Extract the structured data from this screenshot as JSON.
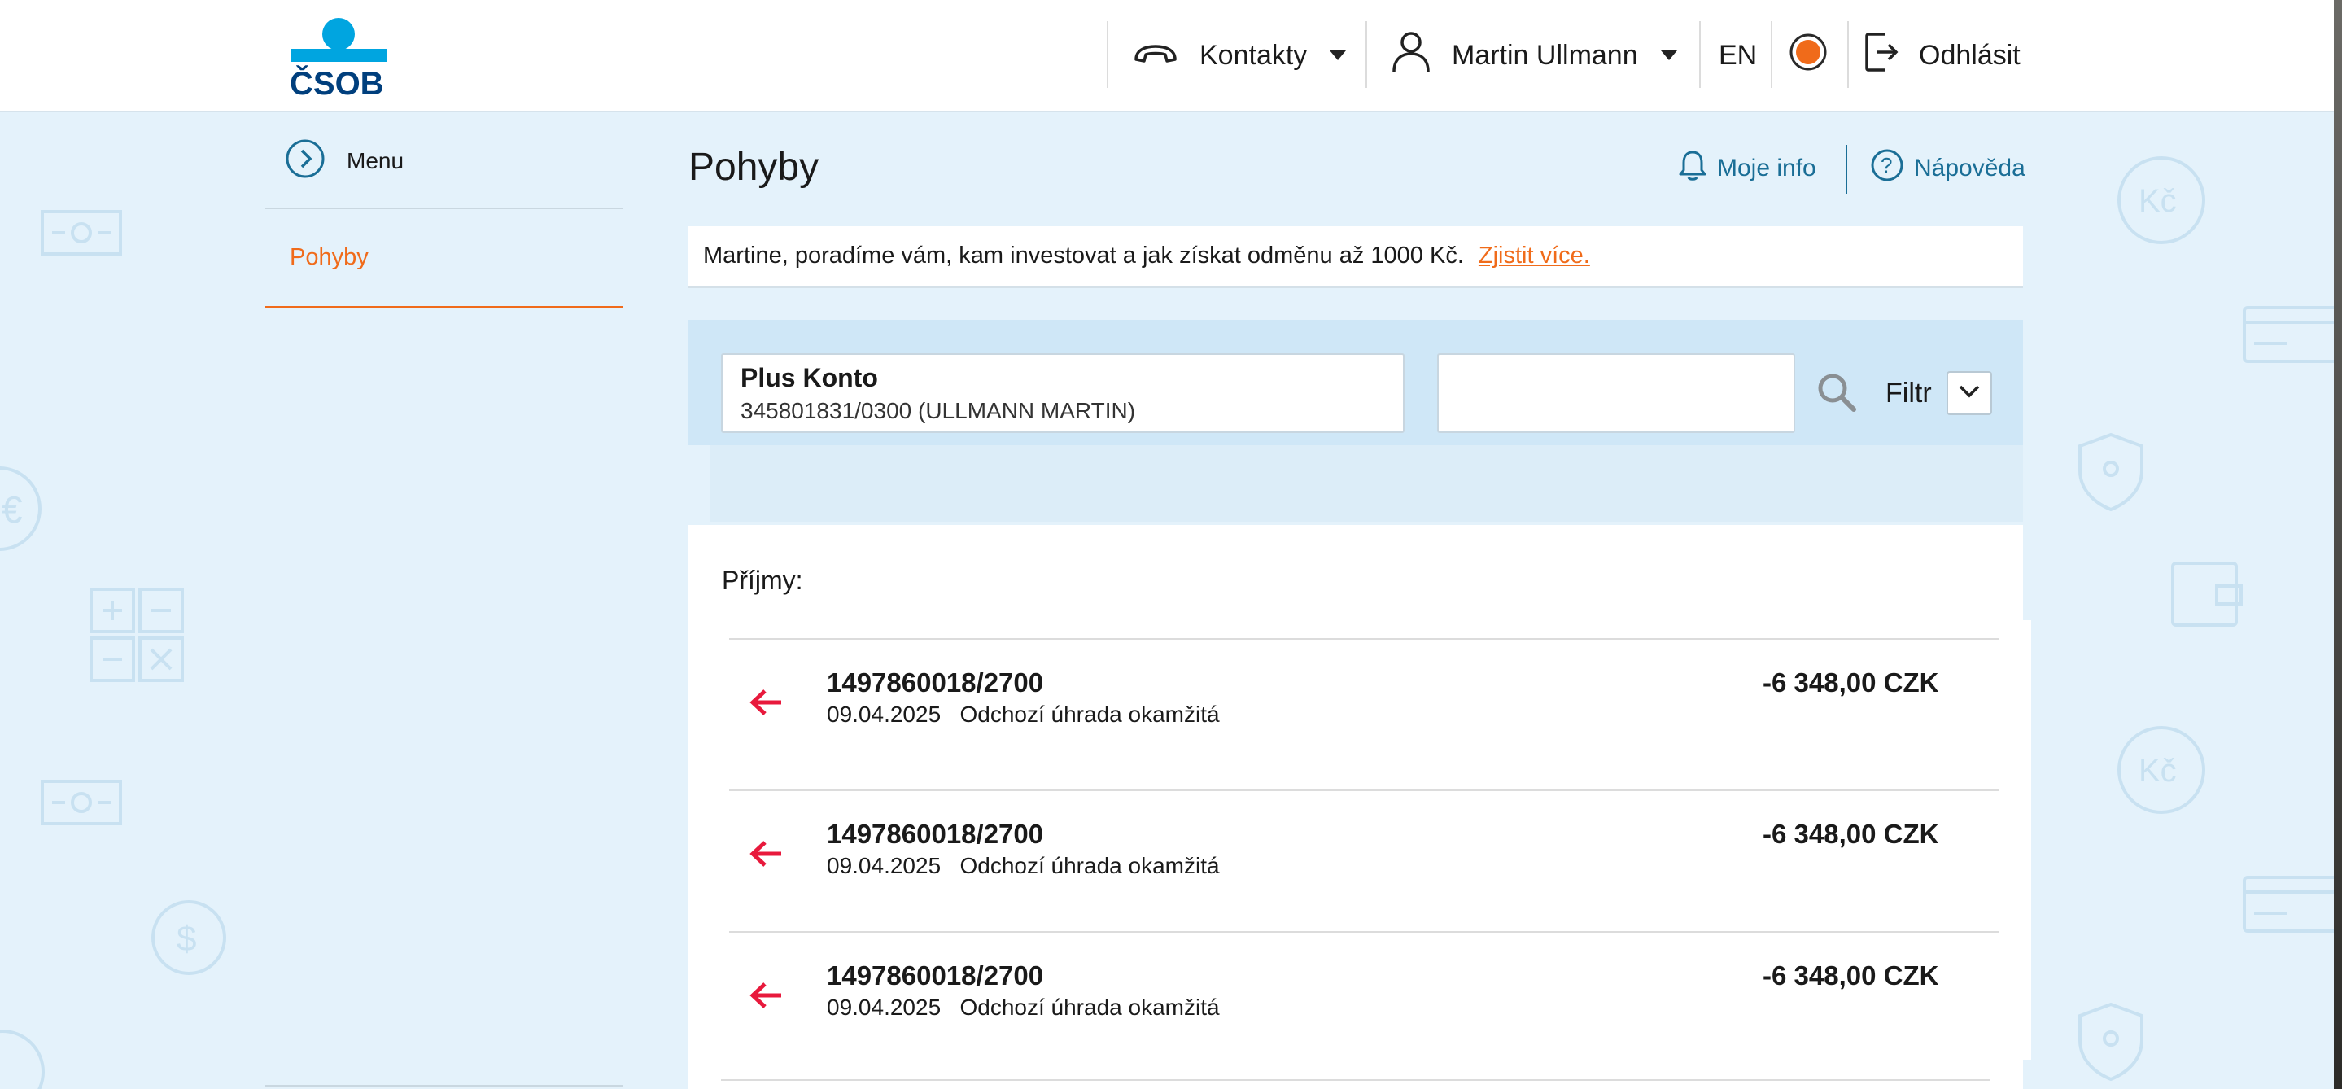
{
  "brand": {
    "logo_text": "ČSOB"
  },
  "topbar": {
    "contacts_label": "Kontakty",
    "user_name": "Martin Ullmann",
    "language": "EN",
    "logout_label": "Odhlásit"
  },
  "sidebar": {
    "menu_label": "Menu",
    "items": [
      {
        "label": "Pohyby",
        "active": true
      }
    ]
  },
  "main": {
    "title": "Pohyby",
    "my_info_label": "Moje info",
    "help_label": "Nápověda",
    "promo": {
      "text": "Martine, poradíme vám, kam investovat a jak získat odměnu až 1000 Kč.",
      "link": "Zjistit více."
    },
    "account": {
      "name": "Plus Konto",
      "number": "345801831/0300  (ULLMANN MARTIN)"
    },
    "search": {
      "value": "",
      "placeholder": ""
    },
    "filter_label": "Filtr",
    "income_label": "Příjmy:",
    "transactions": [
      {
        "account": "1497860018/2700",
        "date": "09.04.2025",
        "type": "Odchozí úhrada okamžitá",
        "amount": "-6 348,00 CZK"
      },
      {
        "account": "1497860018/2700",
        "date": "09.04.2025",
        "type": "Odchozí úhrada okamžitá",
        "amount": "-6 348,00 CZK"
      },
      {
        "account": "1497860018/2700",
        "date": "09.04.2025",
        "type": "Odchozí úhrada okamžitá",
        "amount": "-6 348,00 CZK"
      }
    ]
  },
  "colors": {
    "accent_orange": "#f06b1a",
    "link_blue": "#1a6e96",
    "brand_blue": "#003f7d",
    "brand_cyan": "#00a5e0",
    "outgoing_arrow": "#e8193c",
    "page_background": "#e4f2fb"
  },
  "icons": {
    "contacts": "phone-handset-icon",
    "user": "user-icon",
    "status": "orange-status-dot-icon",
    "logout": "logout-icon",
    "menu": "chevron-right-circle-icon",
    "my_info": "bell-icon",
    "help": "question-circle-icon",
    "search": "magnifier-icon",
    "filter": "chevron-down-icon",
    "transaction": "arrow-left-icon"
  }
}
